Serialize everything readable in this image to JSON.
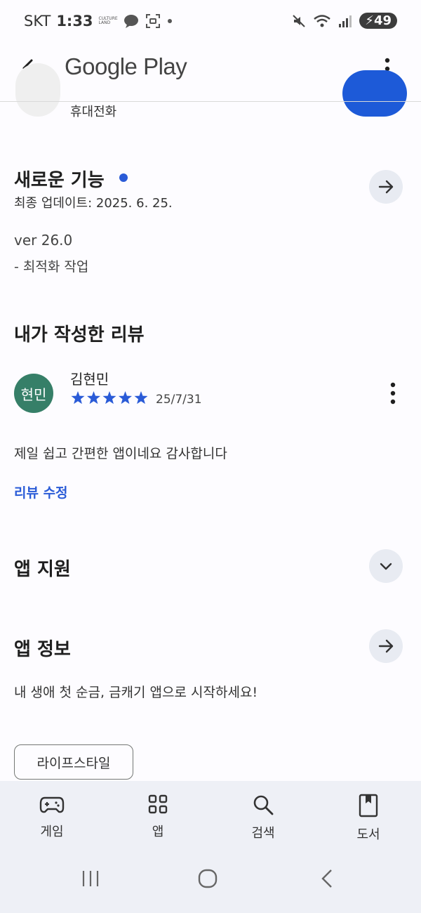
{
  "status_bar": {
    "carrier": "SKT",
    "time": "1:33",
    "mini_logo_text": "CULTURE LAND",
    "battery": "49"
  },
  "app_bar": {
    "title": "Google Play"
  },
  "partial_header": {
    "subtitle": "휴대전화"
  },
  "whats_new": {
    "title": "새로운 기능",
    "updated": "최종 업데이트: 2025. 6. 25.",
    "version": "ver 26.0",
    "notes": "- 최적화 작업"
  },
  "my_review": {
    "section_title": "내가 작성한 리뷰",
    "avatar_text": "현민",
    "reviewer": "김현민",
    "rating": 5,
    "date": "25/7/31",
    "text": "제일 쉽고 간편한 앱이네요 감사합니다",
    "edit_label": "리뷰 수정"
  },
  "app_support": {
    "title": "앱 지원"
  },
  "app_info": {
    "title": "앱 정보",
    "description": "내 생애 첫 순금, 금캐기 앱으로 시작하세요!",
    "category_chip": "라이프스타일"
  },
  "bottom_nav": [
    {
      "label": "게임",
      "icon": "gamepad-icon"
    },
    {
      "label": "앱",
      "icon": "apps-grid-icon"
    },
    {
      "label": "검색",
      "icon": "search-icon"
    },
    {
      "label": "도서",
      "icon": "book-icon"
    }
  ],
  "colors": {
    "accent": "#2a5bd7",
    "avatar": "#367f68",
    "nav_bg": "#eef0f6",
    "round_button_bg": "#e8ebf2"
  }
}
